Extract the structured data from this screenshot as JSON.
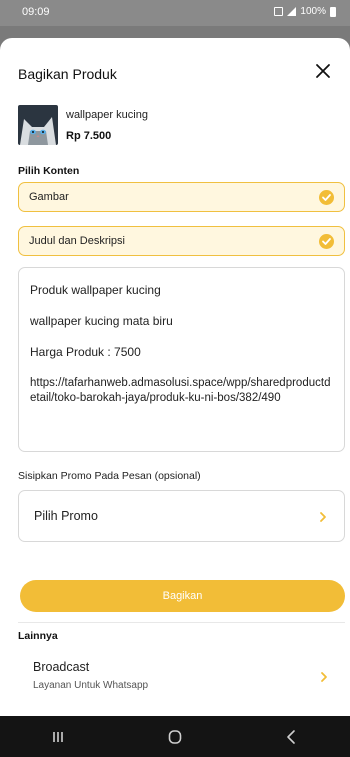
{
  "status": {
    "time": "09:09",
    "battery": "100%"
  },
  "sheet": {
    "title": "Bagikan Produk",
    "product": {
      "name": "wallpaper kucing",
      "price": "Rp 7.500"
    },
    "content_label": "Pilih Konten",
    "options": [
      {
        "label": "Gambar",
        "checked": true
      },
      {
        "label": "Judul dan Deskripsi",
        "checked": true
      }
    ],
    "message": {
      "line1": "Produk wallpaper kucing",
      "line2": "wallpaper kucing mata biru",
      "line3": "Harga Produk : 7500",
      "link": "https://tafarhanweb.admasolusi.space/wpp/sharedproductdetail/toko-barokah-jaya/produk-ku-ni-bos/382/490"
    },
    "promo": {
      "label": "Sisipkan Promo Pada Pesan (opsional)",
      "select_label": "Pilih Promo"
    },
    "share_button": "Bagikan",
    "other": {
      "label": "Lainnya",
      "broadcast_title": "Broadcast",
      "broadcast_subtitle": "Layanan Untuk Whatsapp"
    }
  },
  "colors": {
    "accent": "#f2bd37",
    "option_bg": "#fff7df",
    "option_border": "#f0c040"
  },
  "icons": {
    "close": "close-icon",
    "check": "check-circle-icon",
    "chevron": "chevron-right-icon",
    "nav": [
      "recent-apps-icon",
      "home-icon",
      "back-icon"
    ]
  }
}
